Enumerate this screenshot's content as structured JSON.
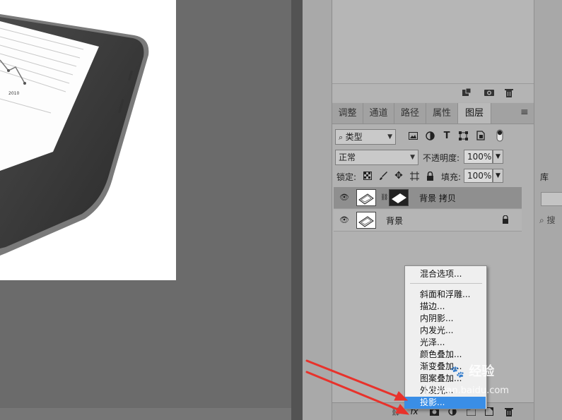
{
  "top_panel": {
    "icons": [
      "new-channel-icon",
      "camera-icon",
      "trash-icon"
    ]
  },
  "tabs": [
    {
      "label": "调整"
    },
    {
      "label": "通道"
    },
    {
      "label": "路径"
    },
    {
      "label": "属性"
    },
    {
      "label": "图层",
      "active": true
    }
  ],
  "filter": {
    "kind_label": "类型",
    "icons": [
      "image-filter-icon",
      "adjustment-filter-icon",
      "text-filter-icon",
      "shape-filter-icon",
      "smart-object-filter-icon",
      "toggle-filter-icon"
    ]
  },
  "blend": {
    "mode": "正常",
    "opacity_label": "不透明度:",
    "opacity_value": "100%"
  },
  "lock": {
    "label": "锁定:",
    "fill_label": "填充:",
    "fill_value": "100%",
    "icons": [
      "lock-transparent-icon",
      "lock-paint-icon",
      "lock-move-icon",
      "lock-artboard-icon",
      "lock-all-icon"
    ]
  },
  "layers": [
    {
      "name": "背景 拷贝",
      "selected": true,
      "has_mask": true,
      "locked": false
    },
    {
      "name": "背景",
      "selected": false,
      "has_mask": false,
      "locked": true
    }
  ],
  "context_menu": {
    "header_item": "混合选项...",
    "items": [
      "斜面和浮雕...",
      "描边...",
      "内阴影...",
      "内发光...",
      "光泽...",
      "颜色叠加...",
      "渐变叠加...",
      "图案叠加...",
      "外发光...",
      "投影..."
    ],
    "selected_item": "投影..."
  },
  "bottom_bar": {
    "fx_label": "fx",
    "icons": [
      "link-layers-icon",
      "fx-icon",
      "add-mask-icon",
      "adjustment-layer-icon",
      "new-group-icon",
      "new-layer-icon",
      "delete-layer-icon"
    ]
  },
  "right_panel": {
    "title": "库",
    "search_glyph": "⌕ 搜"
  },
  "watermark": {
    "brand": "经验",
    "url": "jingyan.baidu.com"
  },
  "document": {
    "chart_label": "2010"
  },
  "colors": {
    "menu_highlight": "#3a8ee6",
    "panel_bg": "#b1b1b1",
    "arrow_red": "#e8322b"
  }
}
